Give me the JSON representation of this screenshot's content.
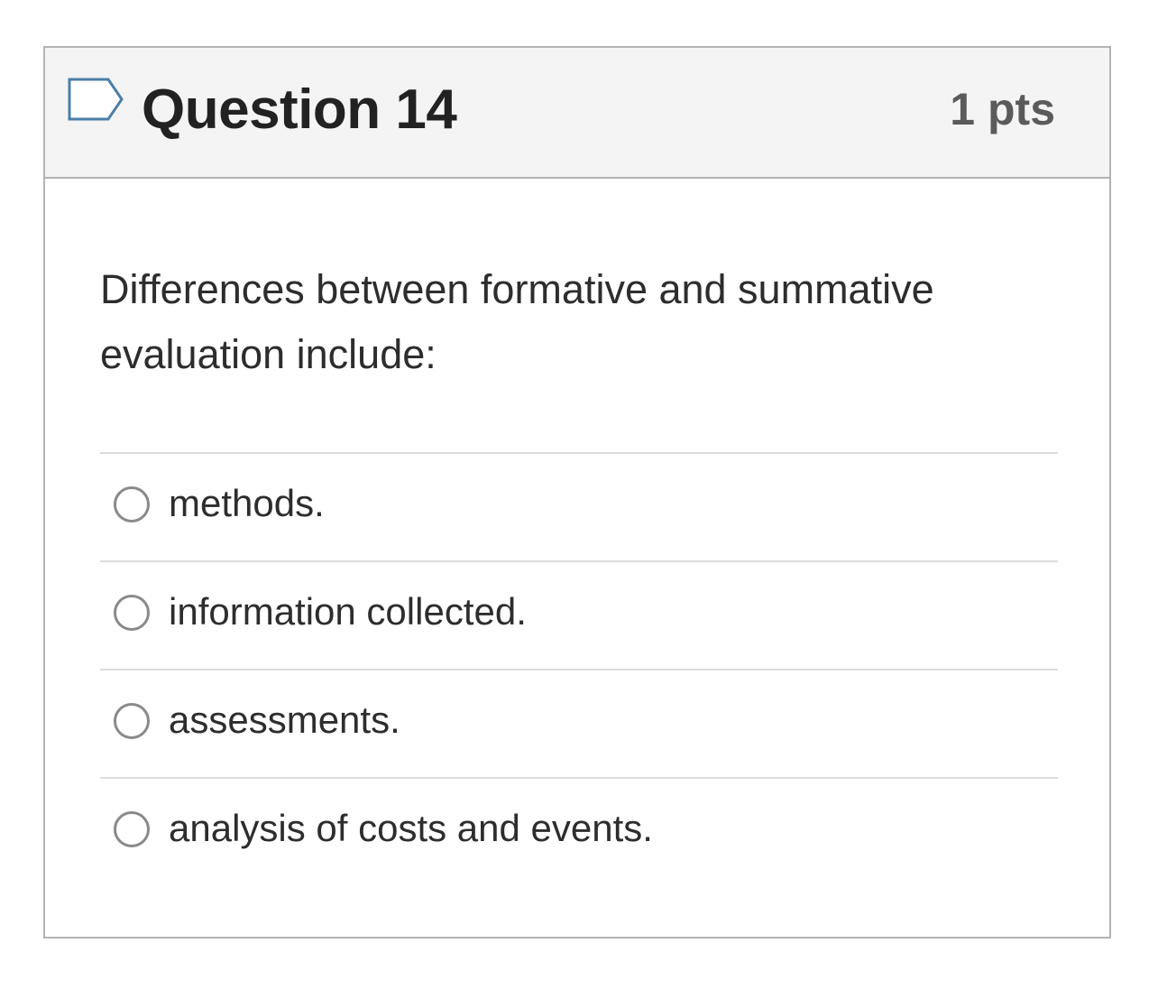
{
  "question": {
    "title": "Question 14",
    "points": "1 pts",
    "text": "Differences between formative and summative evaluation include:",
    "flag_icon": "bookmark-flag-icon"
  },
  "answers": [
    {
      "label": "methods.",
      "selected": false
    },
    {
      "label": "information collected.",
      "selected": false
    },
    {
      "label": "assessments.",
      "selected": false
    },
    {
      "label": "analysis of costs and events.",
      "selected": false
    }
  ],
  "colors": {
    "header_bg": "#f4f4f4",
    "border": "#b3b3b3",
    "flag_outline": "#4a7ea8",
    "text": "#2d2d2d",
    "points_text": "#5b5b5b",
    "radio_border": "#8a8a8a"
  }
}
